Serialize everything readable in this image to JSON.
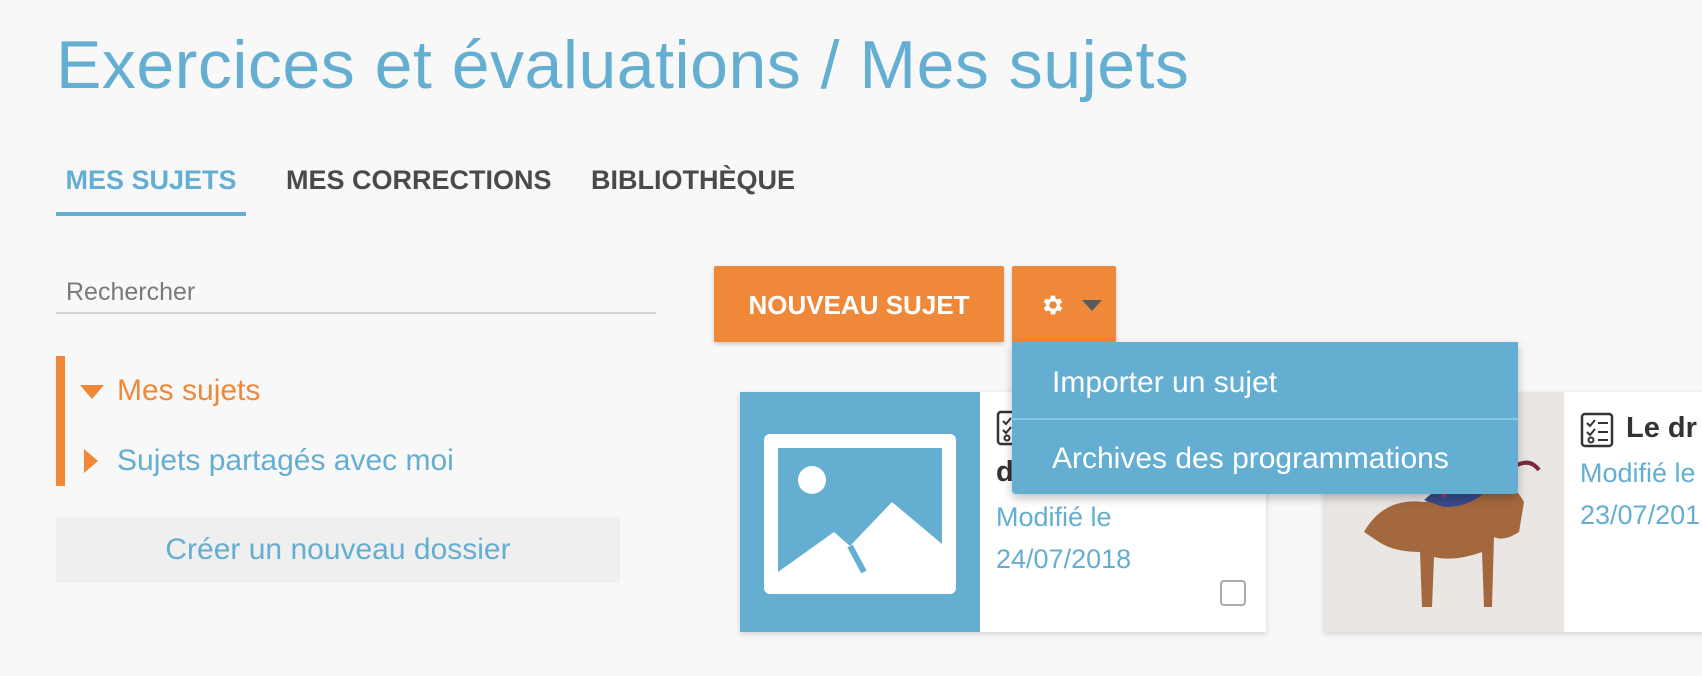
{
  "page": {
    "title": "Exercices et évaluations / Mes sujets"
  },
  "tabs": [
    {
      "label": "MES SUJETS",
      "active": true
    },
    {
      "label": "MES CORRECTIONS",
      "active": false
    },
    {
      "label": "BIBLIOTHÈQUE",
      "active": false
    }
  ],
  "search": {
    "placeholder": "Rechercher",
    "value": ""
  },
  "folders": {
    "items": [
      {
        "label": "Mes sujets",
        "expanded": true
      },
      {
        "label": "Sujets partagés avec moi",
        "expanded": false
      }
    ],
    "create_label": "Créer un nouveau dossier"
  },
  "toolbar": {
    "new_label": "NOUVEAU SUJET",
    "gear_icon": "gear-icon",
    "menu": [
      {
        "label": "Importer un sujet"
      },
      {
        "label": "Archives des programmations"
      }
    ]
  },
  "cards": [
    {
      "title": "d",
      "modified_label": "Modifié le",
      "date": "24/07/2018",
      "icon": "checklist-icon",
      "thumbnail": "image-placeholder-icon"
    },
    {
      "title": "Le dr",
      "modified_label": "Modifié le",
      "date": "23/07/201",
      "icon": "checklist-icon",
      "thumbnail": "photo"
    }
  ],
  "colors": {
    "accent_blue": "#64aed2",
    "accent_orange": "#f0883a",
    "background": "#f8f8f8",
    "text_dark": "#4a4a4a"
  }
}
